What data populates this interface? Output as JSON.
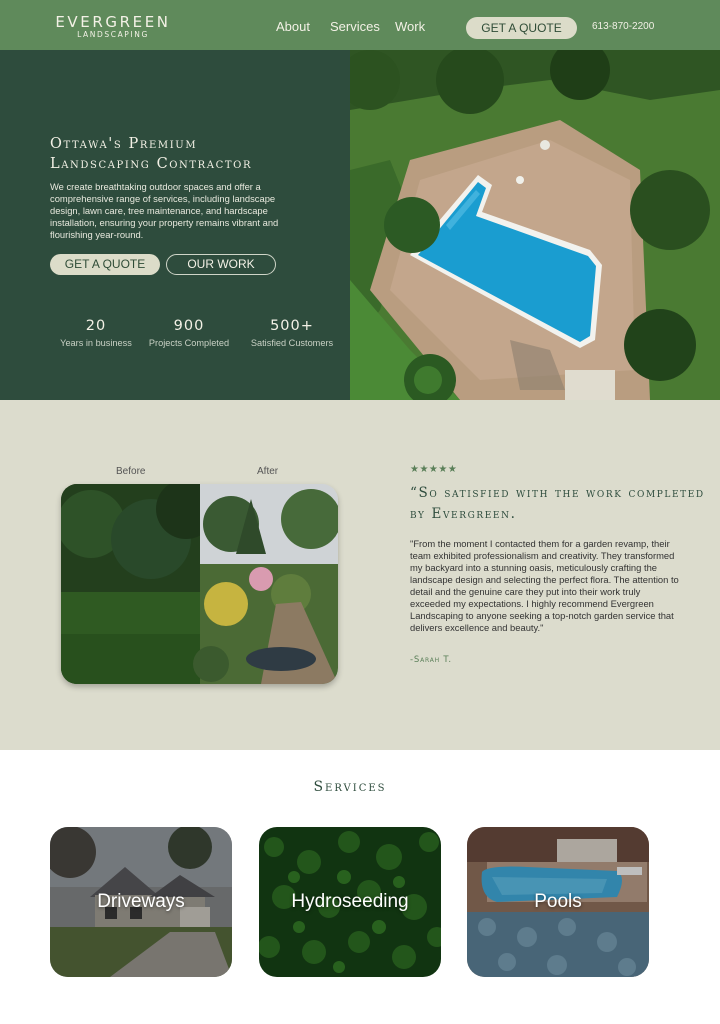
{
  "nav": {
    "logo_main": "EVERGREEN",
    "logo_sub": "LANDSCAPING",
    "links": [
      "About",
      "Services",
      "Work"
    ],
    "cta_label": "GET A QUOTE",
    "phone": "613-870-2200"
  },
  "hero": {
    "title_line1": "Ottawa's Premium",
    "title_line2": "Landscaping Contractor",
    "description": "We create breathtaking outdoor spaces and offer a comprehensive range of services, including landscape design, lawn care, tree maintenance, and hardscape installation, ensuring your property remains vibrant and flourishing year-round.",
    "quote_button": "GET A QUOTE",
    "work_button": "OUR WORK",
    "stats": [
      {
        "number": "20",
        "label": "Years in business"
      },
      {
        "number": "900",
        "label": "Projects Completed"
      },
      {
        "number": "500+",
        "label": "Satisfied Customers"
      }
    ]
  },
  "testimonial": {
    "before_label": "Before",
    "after_label": "After",
    "stars": "★★★★★",
    "rating": 5,
    "title": "“So satisfied with the work completed by Evergreen.",
    "text": "\"From the moment I contacted them for a garden revamp, their team exhibited professionalism and creativity. They transformed my backyard into a stunning oasis, meticulously crafting the landscape design and selecting the perfect flora. The attention to detail and the genuine care they put into their work truly exceeded my expectations. I highly recommend Evergreen Landscaping to anyone seeking a top-notch garden service that delivers excellence and beauty.\"",
    "author": "-Sarah T."
  },
  "services": {
    "title": "Services",
    "items": [
      {
        "label": "Driveways"
      },
      {
        "label": "Hydroseeding"
      },
      {
        "label": "Pools"
      }
    ]
  },
  "colors": {
    "nav_green": "#5f8a5b",
    "dark_green": "#2e4c3d",
    "cream": "#dcdccd",
    "button_cream": "#dcdcc9"
  }
}
